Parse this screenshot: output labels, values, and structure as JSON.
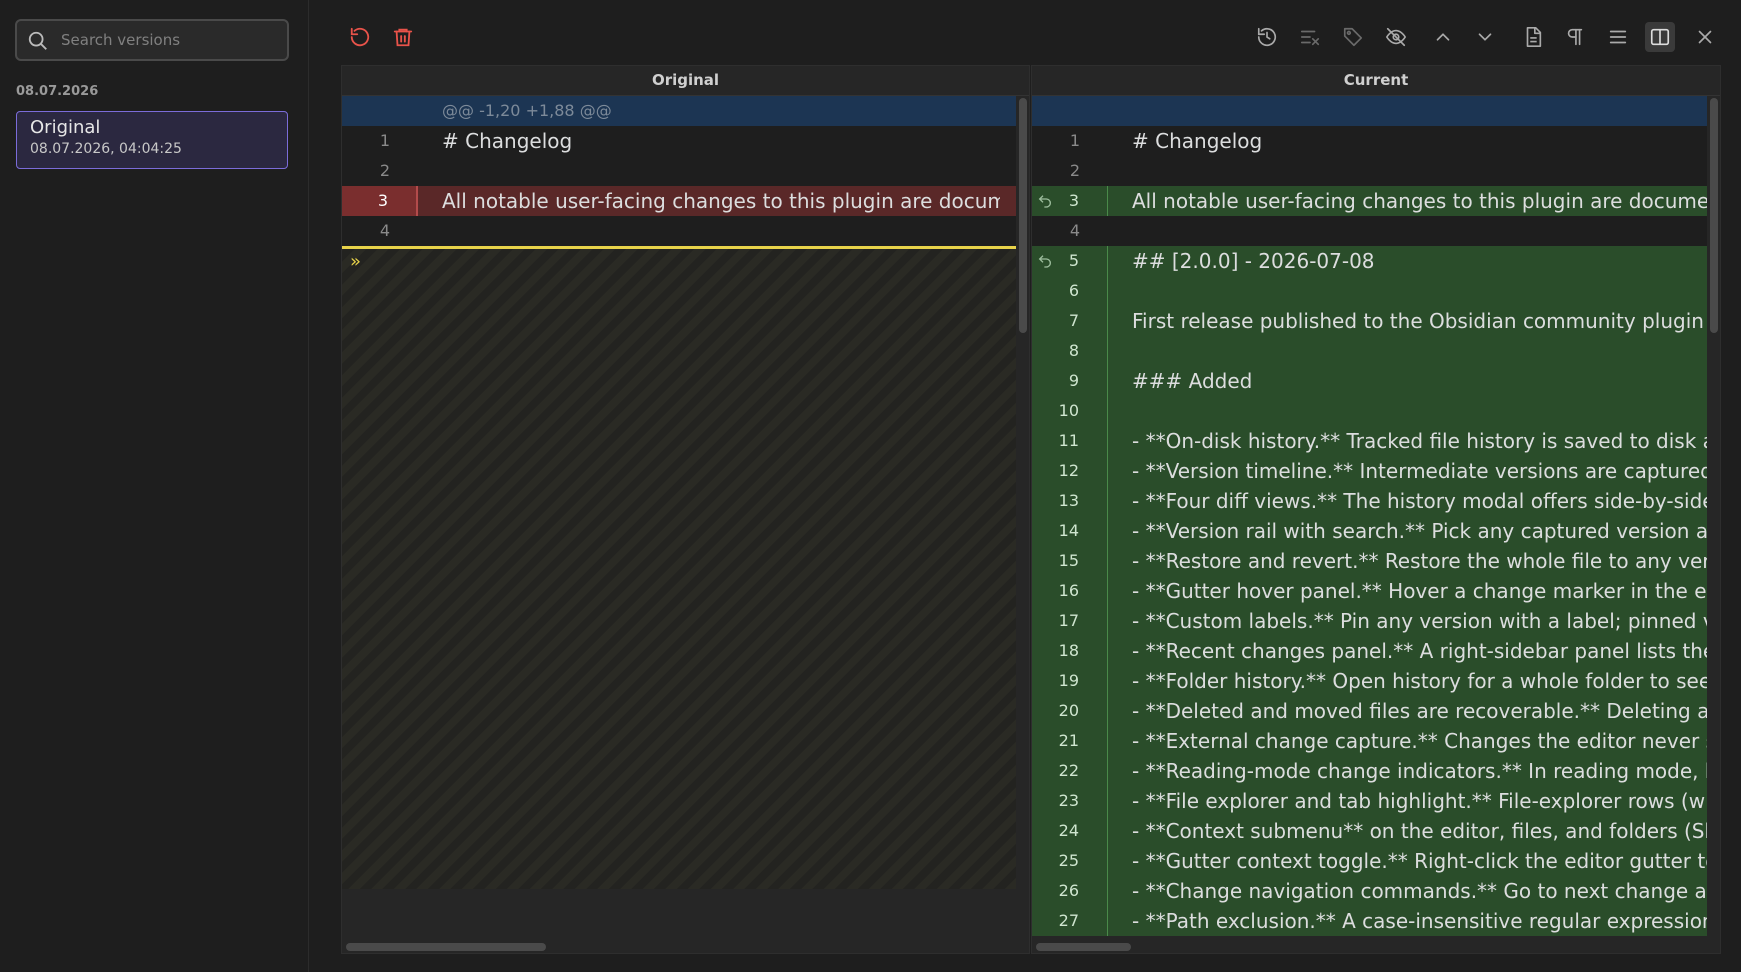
{
  "search": {
    "placeholder": "Search versions"
  },
  "sidebar": {
    "date_group": "08.07.2026",
    "versions": [
      {
        "title": "Original",
        "timestamp": "08.07.2026, 04:04:25"
      }
    ]
  },
  "toolbar": {
    "left": [
      "revert-icon",
      "trash-icon"
    ],
    "right": [
      "history-icon",
      "clear-format-icon",
      "tag-icon",
      "eye-off-icon",
      "chevron-up-icon",
      "chevron-down-icon",
      "file-icon",
      "pilcrow-icon",
      "menu-icon",
      "split-view-icon",
      "close-icon"
    ],
    "accent": "#e8534a"
  },
  "left_pane": {
    "header": "Original",
    "hunk": "@@ -1,20 +1,88 @@",
    "lines": [
      {
        "num": "1",
        "text": "# Changelog",
        "type": "plain"
      },
      {
        "num": "2",
        "text": "",
        "type": "plain"
      },
      {
        "num": "3",
        "text": "All notable user-facing changes to this plugin are documented",
        "type": "del"
      },
      {
        "num": "4",
        "text": "",
        "type": "plain"
      }
    ],
    "collapse_marker": "»"
  },
  "right_pane": {
    "header": "Current",
    "lines": [
      {
        "num": "1",
        "text": "# Changelog",
        "type": "plain"
      },
      {
        "num": "2",
        "text": "",
        "type": "plain"
      },
      {
        "num": "3",
        "text": "All notable user-facing changes to this plugin are documented",
        "type": "add"
      },
      {
        "num": "4",
        "text": "",
        "type": "plain"
      },
      {
        "num": "5",
        "text": "## [2.0.0] - 2026-07-08",
        "type": "add"
      },
      {
        "num": "6",
        "text": "",
        "type": "add"
      },
      {
        "num": "7",
        "text": "First release published to the Obsidian community plugin directory",
        "type": "add"
      },
      {
        "num": "8",
        "text": "",
        "type": "add"
      },
      {
        "num": "9",
        "text": "### Added",
        "type": "add"
      },
      {
        "num": "10",
        "text": "",
        "type": "add"
      },
      {
        "num": "11",
        "text": "- **On-disk history.** Tracked file history is saved to disk and",
        "type": "add"
      },
      {
        "num": "12",
        "text": "- **Version timeline.** Intermediate versions are captured as",
        "type": "add"
      },
      {
        "num": "13",
        "text": "- **Four diff views.** The history modal offers side-by-side, line",
        "type": "add"
      },
      {
        "num": "14",
        "text": "- **Version rail with search.** Pick any captured version as the",
        "type": "add"
      },
      {
        "num": "15",
        "text": "- **Restore and revert.** Restore the whole file to any version",
        "type": "add"
      },
      {
        "num": "16",
        "text": "- **Gutter hover panel.** Hover a change marker in the editor",
        "type": "add"
      },
      {
        "num": "17",
        "text": "- **Custom labels.** Pin any version with a label; pinned versions",
        "type": "add"
      },
      {
        "num": "18",
        "text": "- **Recent changes panel.** A right-sidebar panel lists the active",
        "type": "add"
      },
      {
        "num": "19",
        "text": "- **Folder history.** Open history for a whole folder to see what",
        "type": "add"
      },
      {
        "num": "20",
        "text": "- **Deleted and moved files are recoverable.** Deleting a file",
        "type": "add"
      },
      {
        "num": "21",
        "text": "- **External change capture.** Changes the editor never saw",
        "type": "add"
      },
      {
        "num": "22",
        "text": "- **Reading-mode change indicators.** In reading mode, blocks",
        "type": "add"
      },
      {
        "num": "23",
        "text": "- **File explorer and tab highlight.** File-explorer rows (with tabs",
        "type": "add"
      },
      {
        "num": "24",
        "text": "- **Context submenu** on the editor, files, and folders (Show",
        "type": "add"
      },
      {
        "num": "25",
        "text": "- **Gutter context toggle.** Right-click the editor gutter to show",
        "type": "add"
      },
      {
        "num": "26",
        "text": "- **Change navigation commands.** Go to next change and go",
        "type": "add"
      },
      {
        "num": "27",
        "text": "- **Path exclusion.** A case-insensitive regular expression excludes",
        "type": "add"
      }
    ]
  }
}
